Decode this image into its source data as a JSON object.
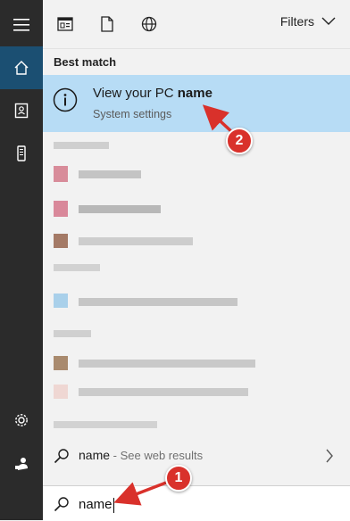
{
  "rail": {
    "items": [
      {
        "name": "menu-icon"
      },
      {
        "name": "home-icon",
        "active": true
      },
      {
        "name": "notebook-icon"
      },
      {
        "name": "device-icon"
      },
      {
        "name": "settings-icon"
      },
      {
        "name": "feedback-icon"
      }
    ]
  },
  "toolbar": {
    "filters_label": "Filters",
    "icons": [
      "apps-icon",
      "documents-icon",
      "web-icon"
    ]
  },
  "results": {
    "section_title": "Best match",
    "best_match": {
      "title_prefix": "View your PC ",
      "title_bold": "name",
      "subtitle": "System settings"
    }
  },
  "web_search": {
    "query": "name",
    "suffix": " - See web results"
  },
  "search": {
    "value": "name"
  },
  "annotations": {
    "marker_1": "1",
    "marker_2": "2"
  },
  "colors": {
    "rail_bg": "#2b2b2b",
    "rail_active": "#1b4f72",
    "highlight": "#b7dcf5",
    "marker": "#d9312b"
  }
}
